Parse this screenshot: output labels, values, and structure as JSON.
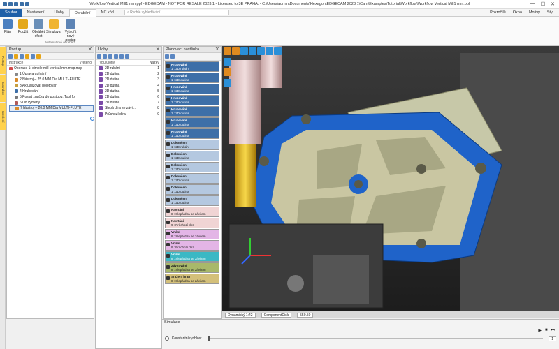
{
  "titlebar": {
    "title": "Workflow Vertical Mill1 mm.ppf - EDGECAM - NOT FOR RESALE 2023.1 - Licensed to 3E PRAHA. - C:\\Users\\admin\\Documents\\Hexagon\\EDGECAM 2023.1\\Cam\\Examples\\Tutorial\\Workflow\\Workflow Vertical Mill1 mm.ppf"
  },
  "menu": {
    "tabs": [
      "Soubor",
      "Nastavení",
      "Úlohy",
      "Obrábění",
      "NC kód"
    ],
    "search_placeholder": "Rychlé vyhledávání",
    "right": [
      "Pokročilé",
      "Okna",
      "Motivy",
      "Styl"
    ]
  },
  "ribbon": {
    "buttons": [
      "Plán",
      "Použít",
      "Obrábět ofset",
      "Simulovat",
      "Vytvořit nový postup"
    ],
    "group_label": "Automatické obrábění"
  },
  "sidetabs": [
    "Postup",
    "Instrukce",
    "Kreslení"
  ],
  "postup": {
    "title": "Postup",
    "col_left": "Instrukce",
    "col_right": "Vřeteno",
    "rows": [
      "Operace 1: simple mill vertical mm.mcp.mcp",
      "1 Úprava upínání",
      "2 Nástroj – 25.0 MM Dia MULTI-FLUTE",
      "3 Aktualizovat polotovar",
      "4 Hrubování",
      "5 Poslat značku do postupu: Tool for",
      "6 Do výměny",
      "7 Nástroj – 20.0 MM Dia MULTI-FLUTE"
    ]
  },
  "ulohy": {
    "title": "Úlohy",
    "col_left": "Typu úlohy",
    "col_right": "Název",
    "rows": [
      {
        "name": "2D rubáni",
        "num": "1"
      },
      {
        "name": "2D dutina",
        "num": "2"
      },
      {
        "name": "2D dutina",
        "num": "3"
      },
      {
        "name": "2D dutina",
        "num": "4"
      },
      {
        "name": "2D dutina",
        "num": "5"
      },
      {
        "name": "2D dutina",
        "num": "6"
      },
      {
        "name": "2D dutina",
        "num": "7"
      },
      {
        "name": "Slepá díra se závi...",
        "num": "8"
      },
      {
        "name": "Průchozí díra",
        "num": "9"
      }
    ]
  },
  "sequence": {
    "title": "Plánovací nástěnka",
    "cards": [
      {
        "title": "Hrubování",
        "sub": "1 : 2D rubání",
        "color": "#3d6fa8"
      },
      {
        "title": "Hrubování",
        "sub": "1 : 2D dutina",
        "color": "#3d6fa8"
      },
      {
        "title": "Hrubování",
        "sub": "1 : 2D dutina",
        "color": "#3d6fa8"
      },
      {
        "title": "Hrubování",
        "sub": "1 : 2D dutina",
        "color": "#3d6fa8"
      },
      {
        "title": "Hrubování",
        "sub": "1 : 2D dutina",
        "color": "#3d6fa8"
      },
      {
        "title": "Hrubování",
        "sub": "1 : 2D dutina",
        "color": "#3d6fa8"
      },
      {
        "title": "Hrubování",
        "sub": "1 : 2D dutina",
        "color": "#3d6fa8"
      },
      {
        "title": "Dokončení",
        "sub": "1 : 2D rubání",
        "color": "#b4c8e0"
      },
      {
        "title": "Dokončení",
        "sub": "1 : 2D dutina",
        "color": "#b4c8e0"
      },
      {
        "title": "Dokončení",
        "sub": "1 : 2D dutina",
        "color": "#b4c8e0"
      },
      {
        "title": "Dokončení",
        "sub": "1 : 2D dutina",
        "color": "#b4c8e0"
      },
      {
        "title": "Dokončení",
        "sub": "1 : 2D dutina",
        "color": "#b4c8e0"
      },
      {
        "title": "Dokončení",
        "sub": "1 : 2D dutina",
        "color": "#b4c8e0"
      },
      {
        "title": "Navrtání",
        "sub": "8 : Slepá díra se závitem",
        "color": "#f0d4d4"
      },
      {
        "title": "Navrtání",
        "sub": "9 : Průchozí díra",
        "color": "#f0d4d4"
      },
      {
        "title": "Vrtání",
        "sub": "8 : Slepá díra se závitem",
        "color": "#e3b5e6"
      },
      {
        "title": "Vrtání",
        "sub": "9 : Průchozí díra",
        "color": "#e3b5e6"
      },
      {
        "title": "Vrtání",
        "sub": "8 : Slepá díra se závitem",
        "color": "#3bb8c4"
      },
      {
        "title": "Závitování",
        "sub": "8 : Slepá díra se závitem",
        "color": "#a8b86a"
      },
      {
        "title": "Sražení hran",
        "sub": "8 : Slepá díra se závitem",
        "color": "#d4c07a"
      }
    ]
  },
  "viewport": {
    "mode": "Dynamický 1:42",
    "component": "ComponentDisk",
    "value": "550.50"
  },
  "simulator": {
    "title": "Simulace",
    "const_speed": "Konstantní rychlost",
    "step": "1"
  }
}
